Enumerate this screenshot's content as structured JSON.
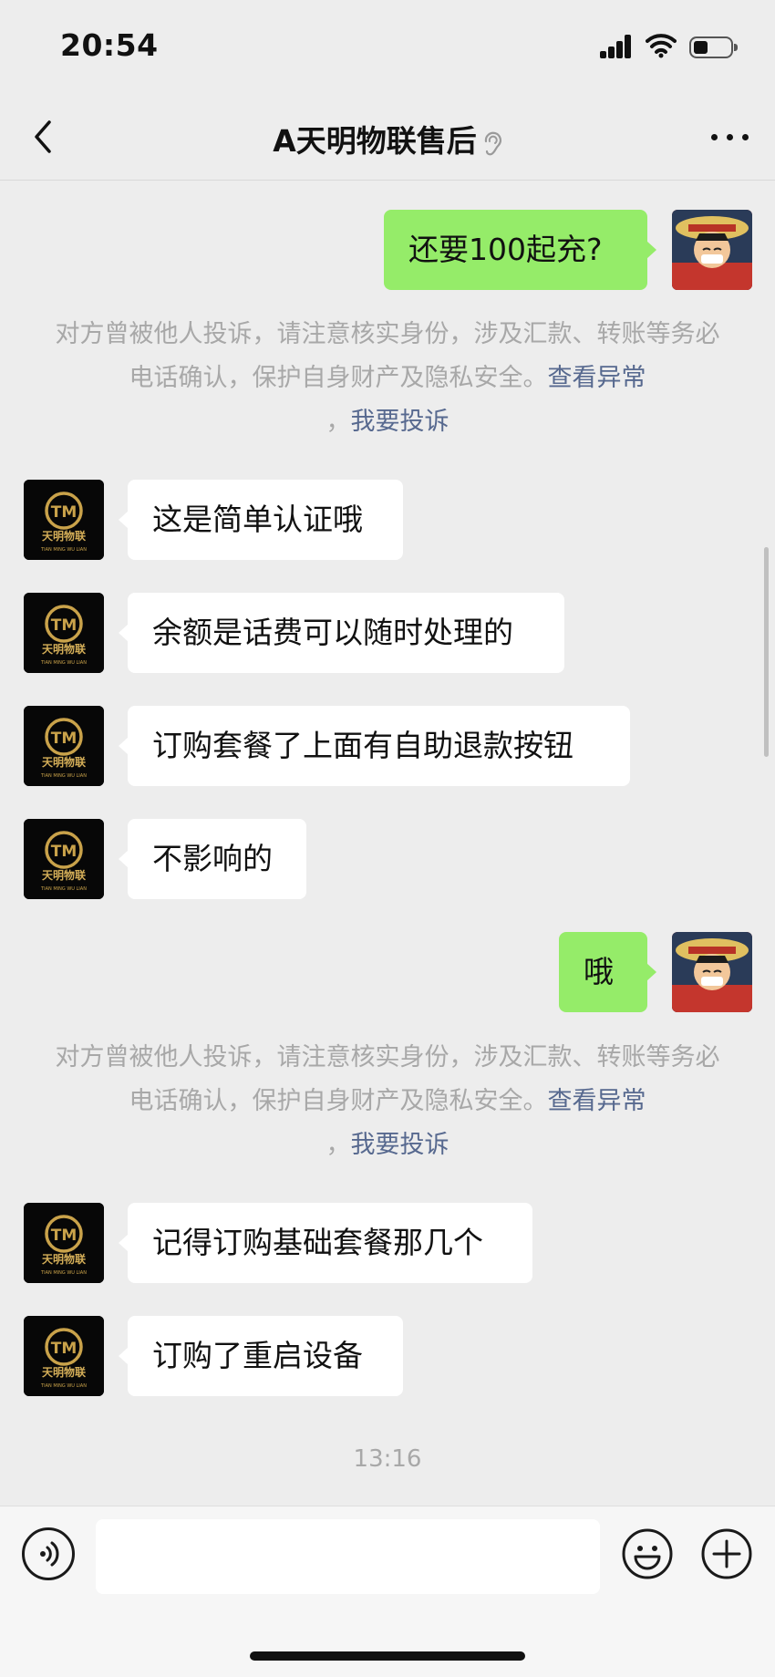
{
  "status_bar": {
    "time": "20:54",
    "battery_level": 0.3
  },
  "header": {
    "title": "A天明物联售后"
  },
  "brand_avatar": {
    "mark": "TM",
    "name": "天明物联",
    "sub": "TIAN MING WU LIAN"
  },
  "messages": [
    {
      "from": "me",
      "text": "还要100起充?"
    },
    {
      "from": "other",
      "text": "这是简单认证哦"
    },
    {
      "from": "other",
      "text": "余额是话费可以随时处理的"
    },
    {
      "from": "other",
      "text": "订购套餐了上面有自助退款按钮"
    },
    {
      "from": "other",
      "text": "不影响的"
    },
    {
      "from": "me",
      "text": "哦"
    },
    {
      "from": "other",
      "text": "记得订购基础套餐那几个"
    },
    {
      "from": "other",
      "text": "订购了重启设备"
    }
  ],
  "notice": {
    "text": "对方曾被他人投诉，请注意核实身份，涉及汇款、转账等务必电话确认，保护自身财产及隐私安全。",
    "link_view": "查看异常",
    "separator": "，",
    "link_report": "我要投诉"
  },
  "timestamp": "13:16",
  "colors": {
    "sent_bubble": "#95ec69",
    "received_bubble": "#ffffff",
    "background": "#ededed",
    "link": "#57698f",
    "brand_gold": "#c9a24a"
  },
  "icons": [
    "back-arrow-icon",
    "ear-icon",
    "more-icon",
    "voice-icon",
    "emoji-icon",
    "plus-icon",
    "signal-icon",
    "wifi-icon",
    "battery-icon"
  ]
}
